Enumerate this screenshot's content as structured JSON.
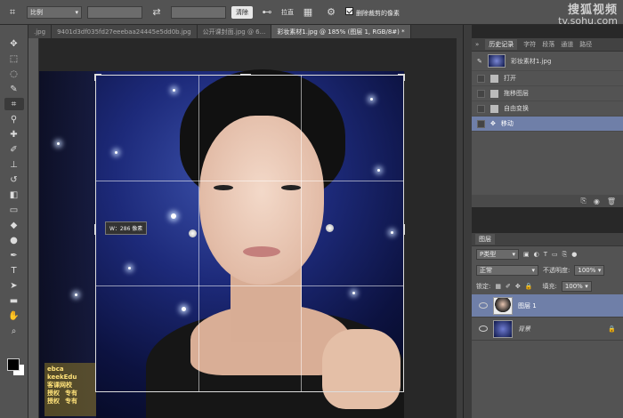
{
  "options_bar": {
    "crop_icon": "crop-icon",
    "ratio_select": "比例",
    "clear_button": "清除",
    "straighten_label": "拉直",
    "delete_cropped_label": "删除裁剪的像素"
  },
  "watermark": {
    "brand": "搜狐视频",
    "url": "tv.sohu.com"
  },
  "tabs": [
    {
      "label": ".jpg"
    },
    {
      "label": "9401d3df035fd27eeebaa24445e5dd0b.jpg"
    },
    {
      "label": "公开课封面.jpg @ 6..."
    },
    {
      "label": "彩妆素材1.jpg @ 185% (图层 1, RGB/8#) *"
    }
  ],
  "canvas": {
    "tooltip": "W：286 像素",
    "logo_lines": [
      "ebca",
      "keekEdu",
      "客课网校",
      "授权",
      "授权",
      "专有",
      "专有"
    ]
  },
  "history_panel": {
    "tabs": [
      "历史记录",
      "字符",
      "段落",
      "通道",
      "路径"
    ],
    "snapshot": "彩妆素材1.jpg",
    "steps": [
      {
        "label": "打开",
        "selected": false
      },
      {
        "label": "拖移图层",
        "selected": false
      },
      {
        "label": "自由变换",
        "selected": false
      },
      {
        "label": "移动",
        "selected": true
      }
    ]
  },
  "layers_panel": {
    "title": "图层",
    "kind_filter": "P类型",
    "blend_mode": "正常",
    "opacity_label": "不透明度:",
    "opacity_value": "100%",
    "lock_label": "锁定:",
    "fill_label": "填充:",
    "fill_value": "100%",
    "layers": [
      {
        "name": "图层 1",
        "selected": true
      },
      {
        "name": "背景",
        "selected": false
      }
    ]
  },
  "colors": {
    "accent": "#6f7fa8",
    "panel": "#535353",
    "background": "#282828"
  }
}
